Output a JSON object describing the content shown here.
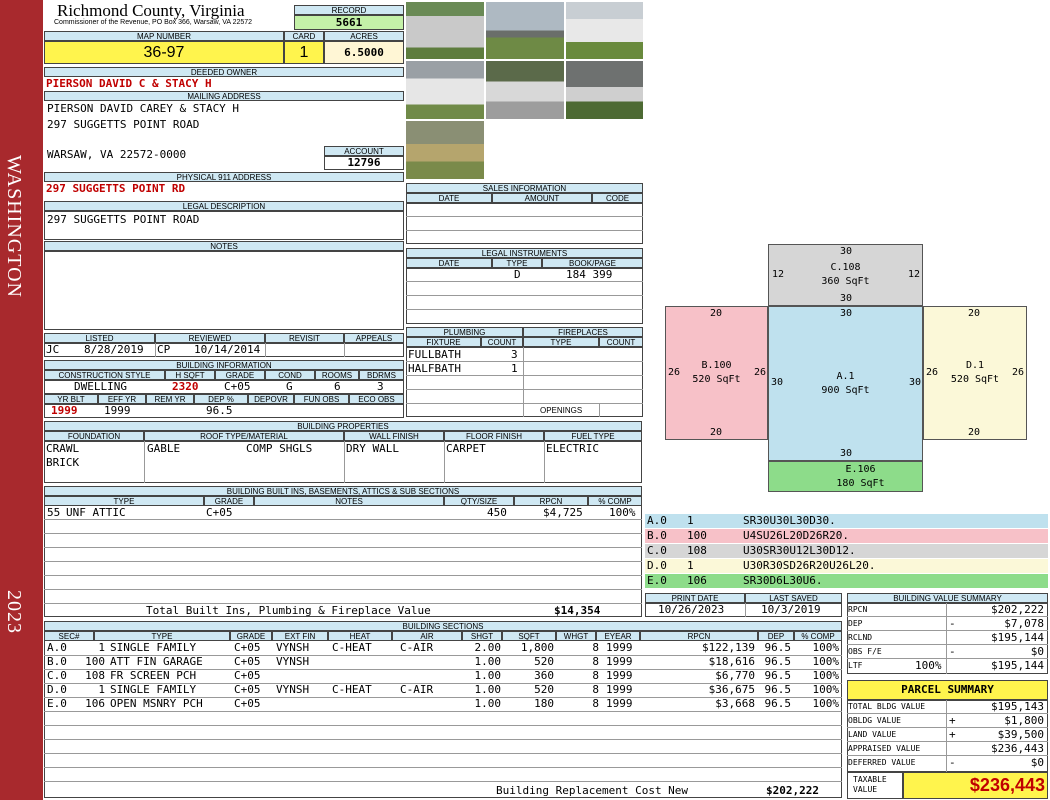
{
  "sidebar": {
    "district": "WASHINGTON",
    "year": "2023"
  },
  "header": {
    "county": "Richmond County, Virginia",
    "subtitle": "Commissioner of the Revenue, PO Box 366, Warsaw, VA 22572"
  },
  "record": {
    "label": "RECORD",
    "value": "5661"
  },
  "map": {
    "label": "MAP NUMBER",
    "value": "36-97"
  },
  "card": {
    "label": "CARD",
    "value": "1"
  },
  "acres": {
    "label": "ACRES",
    "value": "6.5000"
  },
  "owner": {
    "label": "DEEDED OWNER",
    "value": "PIERSON DAVID C & STACY H"
  },
  "mailing": {
    "label": "MAILING ADDRESS",
    "line1": "PIERSON DAVID CAREY & STACY H",
    "line2": "297 SUGGETTS POINT ROAD",
    "line3": "WARSAW, VA 22572-0000"
  },
  "account": {
    "label": "ACCOUNT",
    "value": "12796"
  },
  "physical": {
    "label": "PHYSICAL 911 ADDRESS",
    "value": "297 SUGGETTS POINT RD"
  },
  "legal": {
    "label": "LEGAL DESCRIPTION",
    "value": "297 SUGGETTS POINT ROAD"
  },
  "notes": {
    "label": "NOTES"
  },
  "listing": {
    "listed_label": "LISTED",
    "reviewed_label": "REVIEWED",
    "revisit_label": "REVISIT",
    "appeals_label": "APPEALS",
    "listed_by": "JC",
    "listed_date": "8/28/2019",
    "reviewed_by": "CP",
    "reviewed_date": "10/14/2014"
  },
  "building_info": {
    "label": "BUILDING INFORMATION",
    "h": [
      "CONSTRUCTION STYLE",
      "H SQFT",
      "GRADE",
      "COND",
      "ROOMS",
      "BDRMS"
    ],
    "style": "DWELLING",
    "hsqft": "2320",
    "grade": "C+05",
    "cond": "G",
    "rooms": "6",
    "bdrms": "3",
    "h2": [
      "YR BLT",
      "EFF YR",
      "REM YR",
      "DEP %",
      "DEPOVR",
      "FUN OBS",
      "ECO OBS"
    ],
    "yrblt": "1999",
    "effyr": "1999",
    "dep": "96.5"
  },
  "sales": {
    "label": "SALES INFORMATION",
    "cols": [
      "DATE",
      "AMOUNT",
      "CODE"
    ]
  },
  "instruments": {
    "label": "LEGAL INSTRUMENTS",
    "cols": [
      "DATE",
      "TYPE",
      "BOOK/PAGE"
    ],
    "type": "D",
    "book": "184 399"
  },
  "plumbing": {
    "label": "PLUMBING",
    "cols": [
      "FIXTURE",
      "COUNT"
    ],
    "rows": [
      [
        "FULLBATH",
        "3"
      ],
      [
        "HALFBATH",
        "1"
      ]
    ]
  },
  "fireplaces": {
    "label": "FIREPLACES",
    "cols": [
      "TYPE",
      "COUNT"
    ],
    "openings": "OPENINGS"
  },
  "properties": {
    "label": "BUILDING PROPERTIES",
    "cols": [
      "FOUNDATION",
      "ROOF TYPE/MATERIAL",
      "WALL FINISH",
      "FLOOR FINISH",
      "FUEL TYPE"
    ],
    "foundation1": "CRAWL",
    "foundation2": "BRICK",
    "roof_type": "GABLE",
    "roof_material": "COMP SHGLS",
    "wall": "DRY WALL",
    "floor": "CARPET",
    "fuel": "ELECTRIC"
  },
  "builtins": {
    "label": "BUILDING BUILT INS, BASEMENTS, ATTICS & SUB SECTIONS",
    "cols": [
      "TYPE",
      "GRADE",
      "NOTES",
      "QTY/SIZE",
      "RPCN",
      "% COMP"
    ],
    "row": {
      "code": "55",
      "type": "UNF ATTIC",
      "grade": "C+05",
      "qty": "450",
      "rpcn": "$4,725",
      "comp": "100%"
    },
    "total_label": "Total Built Ins, Plumbing & Fireplace Value",
    "total": "$14,354"
  },
  "dates": {
    "print_label": "PRINT DATE",
    "saved_label": "LAST SAVED",
    "print": "10/26/2023",
    "saved": "10/3/2019"
  },
  "sections": {
    "label": "BUILDING SECTIONS",
    "cols": [
      "SEC#",
      "TYPE",
      "GRADE",
      "EXT FIN",
      "HEAT",
      "AIR",
      "SHGT",
      "SQFT",
      "WHGT",
      "EYEAR",
      "RPCN",
      "DEP",
      "% COMP"
    ],
    "rows": [
      {
        "sec": "A.0",
        "code": "1",
        "type": "SINGLE FAMILY",
        "grade": "C+05",
        "ext": "VYNSH",
        "heat": "C-HEAT",
        "air": "C-AIR",
        "shgt": "2.00",
        "sqft": "1,800",
        "whgt": "8",
        "eyear": "1999",
        "rpcn": "$122,139",
        "dep": "96.5",
        "comp": "100%"
      },
      {
        "sec": "B.0",
        "code": "100",
        "type": "ATT FIN GARAGE",
        "grade": "C+05",
        "ext": "VYNSH",
        "heat": "",
        "air": "",
        "shgt": "1.00",
        "sqft": "520",
        "whgt": "8",
        "eyear": "1999",
        "rpcn": "$18,616",
        "dep": "96.5",
        "comp": "100%"
      },
      {
        "sec": "C.0",
        "code": "108",
        "type": "FR SCREEN PCH",
        "grade": "C+05",
        "ext": "",
        "heat": "",
        "air": "",
        "shgt": "1.00",
        "sqft": "360",
        "whgt": "8",
        "eyear": "1999",
        "rpcn": "$6,770",
        "dep": "96.5",
        "comp": "100%"
      },
      {
        "sec": "D.0",
        "code": "1",
        "type": "SINGLE FAMILY",
        "grade": "C+05",
        "ext": "VYNSH",
        "heat": "C-HEAT",
        "air": "C-AIR",
        "shgt": "1.00",
        "sqft": "520",
        "whgt": "8",
        "eyear": "1999",
        "rpcn": "$36,675",
        "dep": "96.5",
        "comp": "100%"
      },
      {
        "sec": "E.0",
        "code": "106",
        "type": "OPEN MSNRY PCH",
        "grade": "C+05",
        "ext": "",
        "heat": "",
        "air": "",
        "shgt": "1.00",
        "sqft": "180",
        "whgt": "8",
        "eyear": "1999",
        "rpcn": "$3,668",
        "dep": "96.5",
        "comp": "100%"
      }
    ],
    "cost_label": "Building Replacement Cost New",
    "cost": "$202,222"
  },
  "sketch": {
    "C": {
      "name": "C.108",
      "area": "360 SqFt",
      "top": "30",
      "left": "12",
      "right": "12",
      "bottom": "30"
    },
    "B": {
      "name": "B.100",
      "area": "520 SqFt",
      "top": "20",
      "left": "26",
      "right": "26",
      "bottom": "20"
    },
    "A": {
      "name": "A.1",
      "area": "900 SqFt",
      "top": "30",
      "left": "30",
      "right": "30",
      "bottom": "30"
    },
    "D": {
      "name": "D.1",
      "area": "520 SqFt",
      "top": "20",
      "left": "26",
      "right": "26",
      "bottom": "20"
    },
    "E": {
      "name": "E.106",
      "area": "180 SqFt"
    }
  },
  "vectors": [
    {
      "sec": "A.0",
      "code": "1",
      "vec": "SR30U30L30D30.",
      "color": "#bfe1ee"
    },
    {
      "sec": "B.0",
      "code": "100",
      "vec": "U4SU26L20D26R20.",
      "color": "#f7c1c8"
    },
    {
      "sec": "C.0",
      "code": "108",
      "vec": "U30SR30U12L30D12.",
      "color": "#d6d6d6"
    },
    {
      "sec": "D.0",
      "code": "1",
      "vec": "U30R30SD26R20U26L20.",
      "color": "#fbf8d8"
    },
    {
      "sec": "E.0",
      "code": "106",
      "vec": "SR30D6L30U6.",
      "color": "#8ddc8a"
    }
  ],
  "value_summary": {
    "label": "BUILDING VALUE SUMMARY",
    "rpcn_label": "RPCN",
    "rpcn": "$202,222",
    "dep_label": "DEP",
    "dep_sign": "-",
    "dep": "$7,078",
    "rclnd_label": "RCLND",
    "rclnd": "$195,144",
    "obs_label": "OBS F/E",
    "obs_sign": "-",
    "obs": "$0",
    "ltf_label": "LTF",
    "ltf_pct": "100%",
    "ltf": "$195,144"
  },
  "parcel": {
    "label": "PARCEL SUMMARY",
    "bldg_label": "TOTAL BLDG VALUE",
    "bldg": "$195,143",
    "obldg_label": "OBLDG VALUE",
    "obldg_sign": "+",
    "obldg": "$1,800",
    "land_label": "LAND VALUE",
    "land_sign": "+",
    "land": "$39,500",
    "appraised_label": "APPRAISED VALUE",
    "appraised": "$236,443",
    "deferred_label": "DEFERRED VALUE",
    "deferred_sign": "-",
    "deferred": "$0",
    "taxable_label1": "TAXABLE",
    "taxable_label2": "VALUE",
    "taxable": "$236,443"
  }
}
